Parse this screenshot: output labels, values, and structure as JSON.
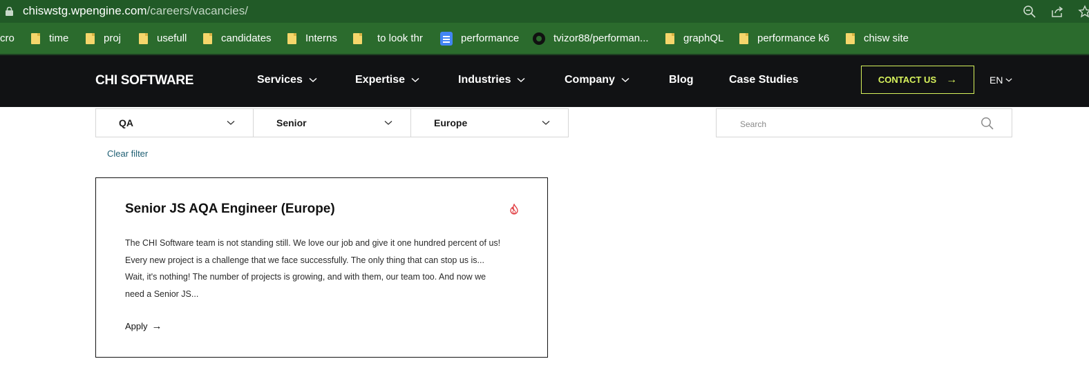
{
  "browser": {
    "url_host": "chiswstg.wpengine.com",
    "url_path": "/careers/vacancies/",
    "bookmarks": [
      {
        "label": "cro",
        "icon": "none"
      },
      {
        "label": "time",
        "icon": "folder-icon"
      },
      {
        "label": "proj",
        "icon": "folder-icon"
      },
      {
        "label": "usefull",
        "icon": "folder-icon"
      },
      {
        "label": "candidates",
        "icon": "folder-icon"
      },
      {
        "label": "Interns",
        "icon": "folder-icon"
      },
      {
        "label": "to look thr",
        "icon": "folder-icon"
      },
      {
        "label": "performance",
        "icon": "google-docs-icon"
      },
      {
        "label": "tvizor88/performan...",
        "icon": "github-icon"
      },
      {
        "label": "graphQL",
        "icon": "folder-icon"
      },
      {
        "label": "performance k6",
        "icon": "folder-icon"
      },
      {
        "label": "chisw site",
        "icon": "folder-icon"
      }
    ]
  },
  "header": {
    "logo": "CHI SOFTWARE",
    "nav": [
      {
        "label": "Services"
      },
      {
        "label": "Expertise"
      },
      {
        "label": "Industries"
      },
      {
        "label": "Company"
      },
      {
        "label": "Blog"
      },
      {
        "label": "Case Studies"
      }
    ],
    "contact_label": "CONTACT US",
    "language": "EN"
  },
  "filters": {
    "department": "QA",
    "level": "Senior",
    "location": "Europe",
    "search_placeholder": "Search",
    "clear_label": "Clear filter"
  },
  "vacancies": [
    {
      "title": "Senior JS AQA Engineer (Europe)",
      "description_lines": [
        "The CHI Software team is not standing still. We love our job and give it one hundred percent of us!",
        "Every new project is a challenge that we face successfully. The only thing that can stop us is...",
        "Wait, it's nothing! The number of projects is growing, and with them, our team too. And now we",
        "need a Senior JS..."
      ],
      "apply_label": "Apply"
    }
  ],
  "colors": {
    "browser_bar": "#215a27",
    "bookmarks_bar": "#2b6b2d",
    "header_bg": "#111214",
    "accent": "#d8f35c",
    "hot_icon": "#e0393e"
  }
}
